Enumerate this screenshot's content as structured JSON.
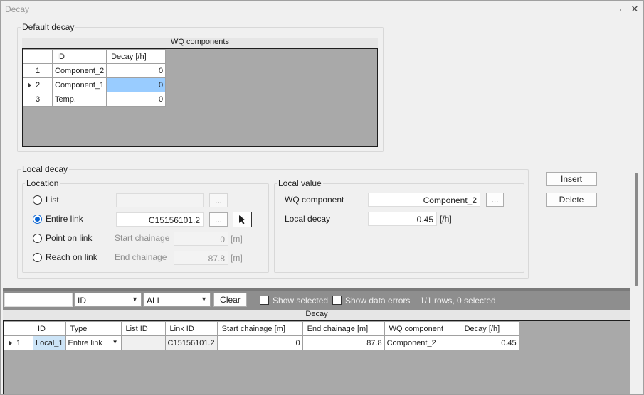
{
  "window": {
    "title": "Decay",
    "restore_glyph": "▫",
    "close_glyph": "✕"
  },
  "default_decay": {
    "legend": "Default decay",
    "caption": "WQ components",
    "columns": [
      "ID",
      "Decay [/h]"
    ],
    "rows": [
      {
        "num": "1",
        "id": "Component_2",
        "decay": "0"
      },
      {
        "num": "2",
        "id": "Component_1",
        "decay": "0"
      },
      {
        "num": "3",
        "id": "Temp.",
        "decay": "0"
      }
    ]
  },
  "local_decay": {
    "legend": "Local decay",
    "insert_label": "Insert",
    "delete_label": "Delete",
    "location": {
      "legend": "Location",
      "list_label": "List",
      "entire_link_label": "Entire link",
      "point_on_link_label": "Point on link",
      "reach_on_link_label": "Reach on link",
      "entire_link_value": "C15156101.2",
      "browse_label": "...",
      "start_chainage_label": "Start chainage",
      "start_chainage_value": "0",
      "end_chainage_label": "End chainage",
      "end_chainage_value": "87.8",
      "unit_m": "[m]"
    },
    "local_value": {
      "legend": "Local value",
      "wq_component_label": "WQ component",
      "wq_component_value": "Component_2",
      "local_decay_label": "Local decay",
      "local_decay_value": "0.45",
      "unit": "[/h]",
      "browse_label": "..."
    }
  },
  "filter": {
    "search_value": "",
    "column_value": "ID",
    "scope_value": "ALL",
    "clear_label": "Clear",
    "show_selected_label": "Show selected",
    "show_errors_label": "Show data errors",
    "status": "1/1 rows, 0 selected"
  },
  "decay_table": {
    "caption": "Decay",
    "columns": [
      "ID",
      "Type",
      "List ID",
      "Link ID",
      "Start chainage [m]",
      "End chainage [m]",
      "WQ component",
      "Decay [/h]"
    ],
    "rows": [
      {
        "num": "1",
        "id": "Local_1",
        "type": "Entire link",
        "list_id": "",
        "link_id": "C15156101.2",
        "start": "0",
        "end": "87.8",
        "wq": "Component_2",
        "decay": "0.45"
      }
    ]
  }
}
